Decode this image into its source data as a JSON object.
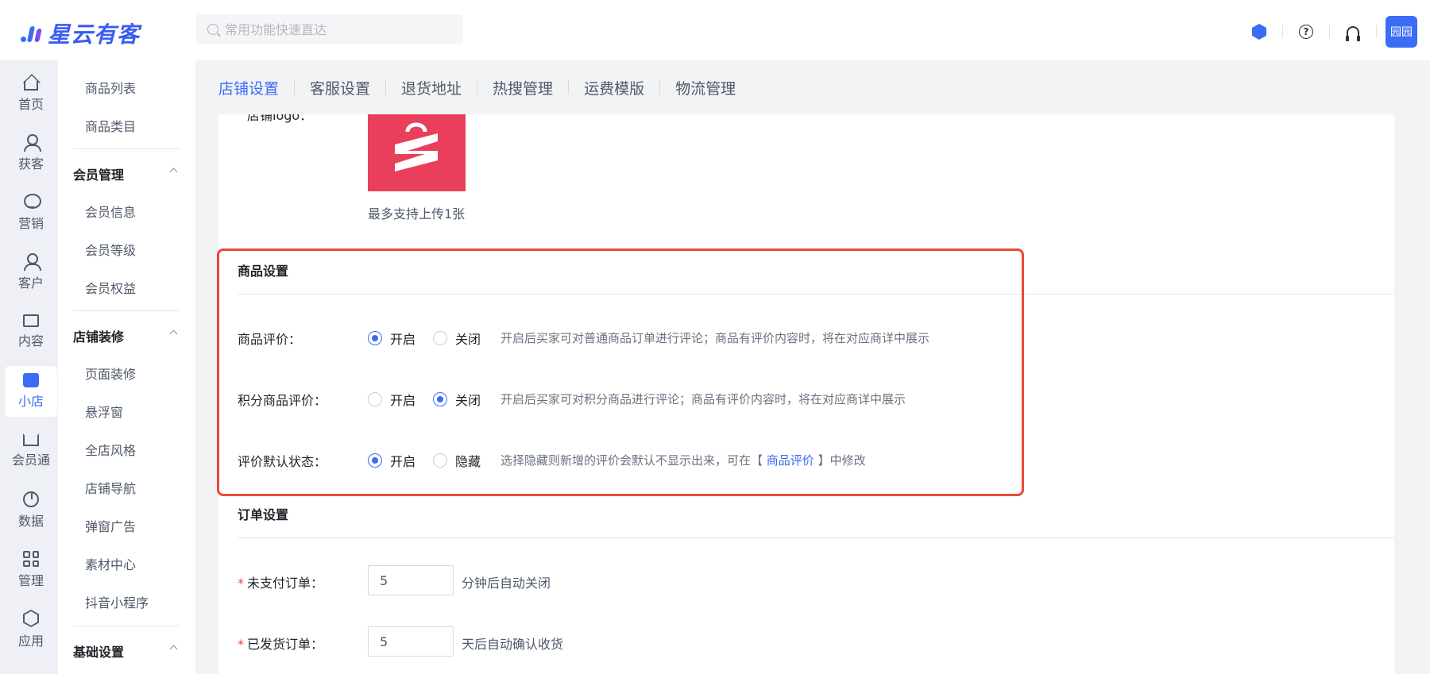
{
  "header": {
    "brand": "星云有客",
    "search_placeholder": "常用功能快速直达",
    "avatar_text": "园园"
  },
  "leftnav": {
    "items": [
      {
        "label": "首页",
        "icon": "home-icon"
      },
      {
        "label": "获客",
        "icon": "user-add-icon"
      },
      {
        "label": "营销",
        "icon": "bulb-icon"
      },
      {
        "label": "客户",
        "icon": "user-icon"
      },
      {
        "label": "内容",
        "icon": "folder-icon"
      },
      {
        "label": "小店",
        "icon": "shop-icon",
        "active": true
      },
      {
        "label": "会员通",
        "icon": "crown-icon"
      },
      {
        "label": "数据",
        "icon": "pie-chart-icon"
      },
      {
        "label": "管理",
        "icon": "grid-icon"
      },
      {
        "label": "应用",
        "icon": "box-icon"
      }
    ]
  },
  "subnav": {
    "items": [
      "商品列表",
      "商品类目"
    ],
    "group_member": "会员管理",
    "member_items": [
      "会员信息",
      "会员等级",
      "会员权益"
    ],
    "group_decor": "店铺装修",
    "decor_items": [
      "页面装修",
      "悬浮窗",
      "全店风格",
      "店铺导航",
      "弹窗广告",
      "素材中心",
      "抖音小程序"
    ],
    "group_basic": "基础设置"
  },
  "tabs": [
    "店铺设置",
    "客服设置",
    "退货地址",
    "热搜管理",
    "运费模版",
    "物流管理"
  ],
  "store": {
    "logo_label": "店铺logo：",
    "upload_tip": "最多支持上传1张"
  },
  "product_settings": {
    "title": "商品设置",
    "review": {
      "label": "商品评价：",
      "opt_on": "开启",
      "opt_off": "关闭",
      "selected": "开启",
      "hint": "开启后买家可对普通商品订单进行评论；商品有评价内容时，将在对应商详中展示"
    },
    "points_review": {
      "label": "积分商品评价：",
      "opt_on": "开启",
      "opt_off": "关闭",
      "selected": "关闭",
      "hint": "开启后买家可对积分商品进行评论；商品有评价内容时，将在对应商详中展示"
    },
    "default_status": {
      "label": "评价默认状态：",
      "opt_on": "开启",
      "opt_off": "隐藏",
      "selected": "开启",
      "hint_pre": "选择隐藏则新增的评价会默认不显示出来，可在【 ",
      "hint_link": "商品评价",
      "hint_post": " 】中修改"
    }
  },
  "order_settings": {
    "title": "订单设置",
    "unpaid": {
      "label": "未支付订单：",
      "value": "5",
      "suffix": "分钟后自动关闭"
    },
    "shipped": {
      "label": "已发货订单：",
      "value": "5",
      "suffix": "天后自动确认收货"
    }
  },
  "colors": {
    "accent": "#3b6cf6",
    "highlight": "#e84a35",
    "logo_bg": "#ea3f5b"
  }
}
